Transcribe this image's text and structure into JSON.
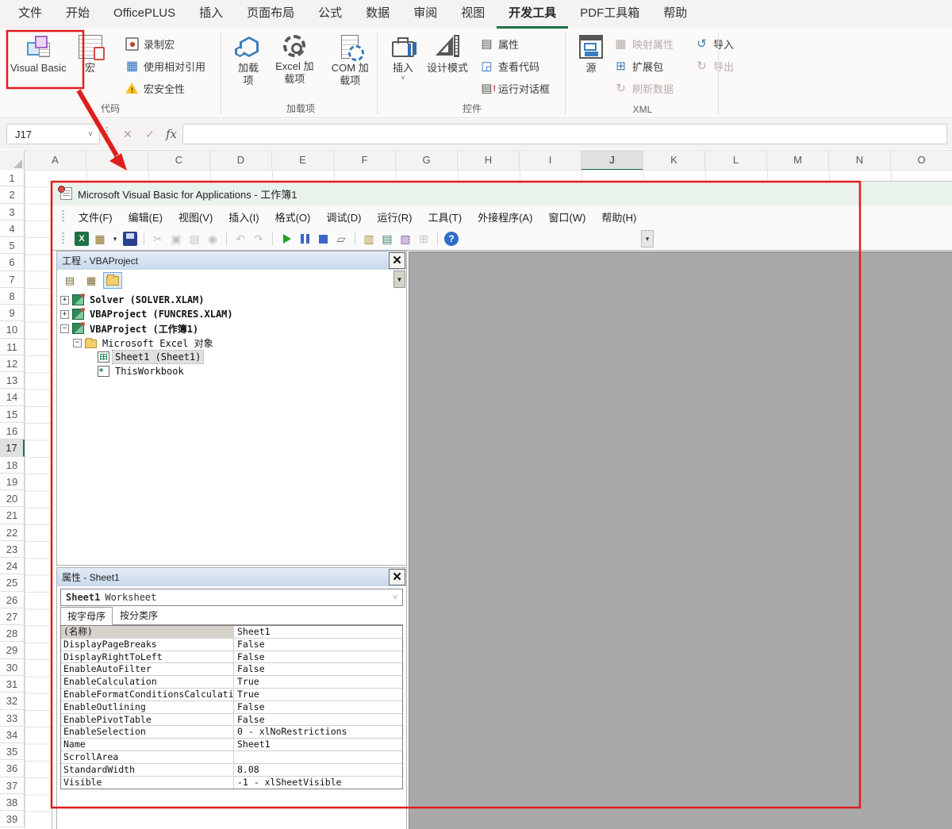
{
  "ribbon": {
    "tabs": [
      {
        "label": "文件"
      },
      {
        "label": "开始"
      },
      {
        "label": "OfficePLUS"
      },
      {
        "label": "插入"
      },
      {
        "label": "页面布局"
      },
      {
        "label": "公式"
      },
      {
        "label": "数据"
      },
      {
        "label": "审阅"
      },
      {
        "label": "视图"
      },
      {
        "label": "开发工具",
        "active": true
      },
      {
        "label": "PDF工具箱"
      },
      {
        "label": "帮助"
      }
    ],
    "code": {
      "label": "代码",
      "big": [
        {
          "label": "Visual Basic",
          "icon": "vb"
        },
        {
          "label": "宏",
          "icon": "macros"
        }
      ],
      "small": [
        {
          "label": "录制宏",
          "icon": "record"
        },
        {
          "label": "使用相对引用",
          "icon": "relref",
          "glyph": "▦"
        },
        {
          "label": "宏安全性",
          "icon": "warning"
        }
      ]
    },
    "addins": {
      "label": "加载项",
      "big": [
        {
          "label": "加载项",
          "icon": "hex"
        },
        {
          "label": "Excel 加载项",
          "icon": "gear"
        },
        {
          "label": "COM 加载项",
          "icon": "comgear"
        }
      ]
    },
    "controls": {
      "label": "控件",
      "big": [
        {
          "label": "插入",
          "icon": "toolbox",
          "caret": true
        },
        {
          "label": "设计模式",
          "icon": "ruler"
        }
      ],
      "small": [
        {
          "label": "属性",
          "icon": "props",
          "glyph": "▤"
        },
        {
          "label": "查看代码",
          "icon": "viewcode",
          "glyph": "◲"
        },
        {
          "label": "运行对话框",
          "icon": "rundlg",
          "glyph": "▤"
        }
      ]
    },
    "xml": {
      "label": "XML",
      "big": [
        {
          "label": "源",
          "icon": "source"
        }
      ],
      "small1": [
        {
          "label": "映射属性",
          "icon": "map",
          "glyph": "▦",
          "disabled": true
        },
        {
          "label": "扩展包",
          "icon": "expansion",
          "glyph": "⊞"
        },
        {
          "label": "刷新数据",
          "icon": "refresh",
          "glyph": "↻",
          "disabled": true
        }
      ],
      "small2": [
        {
          "label": "导入",
          "icon": "import",
          "glyph": "↺"
        },
        {
          "label": "导出",
          "icon": "export",
          "glyph": "↻",
          "disabled": true
        }
      ]
    }
  },
  "formula": {
    "name_box": "J17",
    "cancel": "✕",
    "accept": "✓",
    "fx": "fx",
    "value": ""
  },
  "grid": {
    "columns": [
      {
        "label": "A"
      },
      {
        "label": "B"
      },
      {
        "label": "C"
      },
      {
        "label": "D"
      },
      {
        "label": "E"
      },
      {
        "label": "F"
      },
      {
        "label": "G"
      },
      {
        "label": "H"
      },
      {
        "label": "I"
      },
      {
        "label": "J",
        "selected": true
      },
      {
        "label": "K"
      },
      {
        "label": "L"
      },
      {
        "label": "M"
      },
      {
        "label": "N"
      },
      {
        "label": "O"
      }
    ],
    "rows": {
      "first": 1,
      "last": 39,
      "selected": 17
    }
  },
  "vba": {
    "title": "Microsoft Visual Basic for Applications - 工作簿1",
    "menus": [
      "文件(F)",
      "编辑(E)",
      "视图(V)",
      "插入(I)",
      "格式(O)",
      "调试(D)",
      "运行(R)",
      "工具(T)",
      "外接程序(A)",
      "窗口(W)",
      "帮助(H)"
    ],
    "toolbar": [
      {
        "name": "view-excel-icon",
        "k": "excel",
        "glyph": "X"
      },
      {
        "name": "view-object-icon",
        "k": "viewobj",
        "glyph": "▦"
      },
      {
        "name": "view-dropdown-icon",
        "k": "dd",
        "glyph": "▾"
      },
      {
        "name": "save-icon",
        "k": "save"
      },
      {
        "name": "separator",
        "sep": true
      },
      {
        "name": "cut-icon",
        "glyph": "✂",
        "disabled": true
      },
      {
        "name": "copy-icon",
        "glyph": "▣",
        "disabled": true
      },
      {
        "name": "paste-icon",
        "glyph": "▤",
        "disabled": true
      },
      {
        "name": "find-icon",
        "glyph": "◉",
        "disabled": true
      },
      {
        "name": "separator",
        "sep": true
      },
      {
        "name": "undo-icon",
        "glyph": "↶",
        "disabled": true
      },
      {
        "name": "redo-icon",
        "glyph": "↷",
        "disabled": true
      },
      {
        "name": "separator",
        "sep": true
      },
      {
        "name": "run-icon",
        "k": "run"
      },
      {
        "name": "break-icon",
        "k": "break"
      },
      {
        "name": "reset-icon",
        "k": "reset"
      },
      {
        "name": "design-mode-icon",
        "glyph": "▱"
      },
      {
        "name": "separator",
        "sep": true
      },
      {
        "name": "project-explorer-icon",
        "k": "prjx",
        "glyph": "▥"
      },
      {
        "name": "properties-window-icon",
        "k": "propw",
        "glyph": "▤"
      },
      {
        "name": "object-browser-icon",
        "k": "objb",
        "glyph": "▧"
      },
      {
        "name": "toolbox-icon",
        "glyph": "⊞",
        "disabled": true
      },
      {
        "name": "separator",
        "sep": true
      },
      {
        "name": "help-icon",
        "k": "help",
        "glyph": "?"
      }
    ],
    "toolbar_overflow": "▾",
    "project": {
      "title": "工程 - VBAProject",
      "buttons": [
        {
          "name": "view-code-button",
          "glyph": "▤"
        },
        {
          "name": "view-object-button",
          "glyph": "▦"
        },
        {
          "name": "toggle-folders-button",
          "folder": true,
          "active": true
        }
      ],
      "scroll_arrow": "▼",
      "tree": [
        {
          "label": "Solver (SOLVER.XLAM)",
          "depth": 0,
          "expander": "+",
          "icon": "project",
          "bold": true
        },
        {
          "label": "VBAProject (FUNCRES.XLAM)",
          "depth": 0,
          "expander": "+",
          "icon": "project",
          "bold": true
        },
        {
          "label": "VBAProject (工作簿1)",
          "depth": 0,
          "expander": "−",
          "icon": "project",
          "bold": true
        },
        {
          "label": "Microsoft Excel 对象",
          "depth": 1,
          "expander": "−",
          "icon": "folder"
        },
        {
          "label": "Sheet1 (Sheet1)",
          "depth": 2,
          "leaf": true,
          "icon": "sheet",
          "selected": true
        },
        {
          "label": "ThisWorkbook",
          "depth": 2,
          "leaf": true,
          "icon": "workbook"
        }
      ]
    },
    "properties": {
      "title": "属性 - Sheet1",
      "object_name": "Sheet1",
      "object_type": "Worksheet",
      "tabs": [
        {
          "label": "按字母序",
          "active": true
        },
        {
          "label": "按分类序"
        }
      ],
      "rows": [
        {
          "name": "(名称)",
          "value": "Sheet1",
          "selected": true
        },
        {
          "name": "DisplayPageBreaks",
          "value": "False"
        },
        {
          "name": "DisplayRightToLeft",
          "value": "False"
        },
        {
          "name": "EnableAutoFilter",
          "value": "False"
        },
        {
          "name": "EnableCalculation",
          "value": "True"
        },
        {
          "name": "EnableFormatConditionsCalculation",
          "value": "True"
        },
        {
          "name": "EnableOutlining",
          "value": "False"
        },
        {
          "name": "EnablePivotTable",
          "value": "False"
        },
        {
          "name": "EnableSelection",
          "value": "0 - xlNoRestrictions"
        },
        {
          "name": "Name",
          "value": "Sheet1"
        },
        {
          "name": "ScrollArea",
          "value": ""
        },
        {
          "name": "StandardWidth",
          "value": "8.08"
        },
        {
          "name": "Visible",
          "value": "-1 - xlSheetVisible"
        }
      ]
    }
  },
  "annotations": {
    "color": "#e01e1e",
    "highlight_box_target": "Visual Basic button",
    "window_box_target": "VBA editor window",
    "arrow_target": "VBA editor window"
  }
}
